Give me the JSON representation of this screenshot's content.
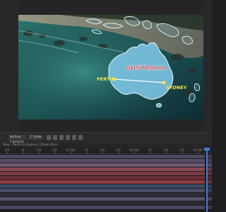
{
  "composition": {
    "labels": {
      "country": "AUSTRALIA",
      "city_west": "PERTH",
      "city_east": "SYDNEY"
    },
    "colors": {
      "country_label": "#e23b3b",
      "city_label": "#f2e64a",
      "route_line": "#ffffff",
      "map_fill": "#7ec6e6"
    }
  },
  "toolbar": {
    "zoom": "Active Camera",
    "resolution": "1 View",
    "icons": [
      "grid-icon",
      "mask-icon",
      "snapshot-icon",
      "channel-icon",
      "color-icon",
      "fast-preview-icon"
    ]
  },
  "timeline": {
    "comp_name": "Map - Perth to Sydney (Zoom Blur)",
    "ruler_ticks": [
      "00f",
      "5f",
      "10f",
      "15f",
      "01:00f",
      "5f",
      "10f",
      "15f",
      "02:00f",
      "5f",
      "10f",
      "15f",
      "03:00f"
    ],
    "tracks": [
      {
        "color": "#4a4a63"
      },
      {
        "color": "#5b4e6c"
      },
      {
        "color": "#6e5a74"
      },
      {
        "color": "#8a4a5a"
      },
      {
        "color": "#7a3b45"
      },
      {
        "color": "#6a3038"
      },
      {
        "color": "#8c3a3e"
      },
      {
        "color": "#3a4a66"
      },
      {
        "color": "#4d4d6a"
      },
      {
        "color": "#2e2e32"
      },
      {
        "color": "#56566e"
      },
      {
        "color": "#2a2a2e"
      },
      {
        "color": "#484862"
      }
    ]
  }
}
